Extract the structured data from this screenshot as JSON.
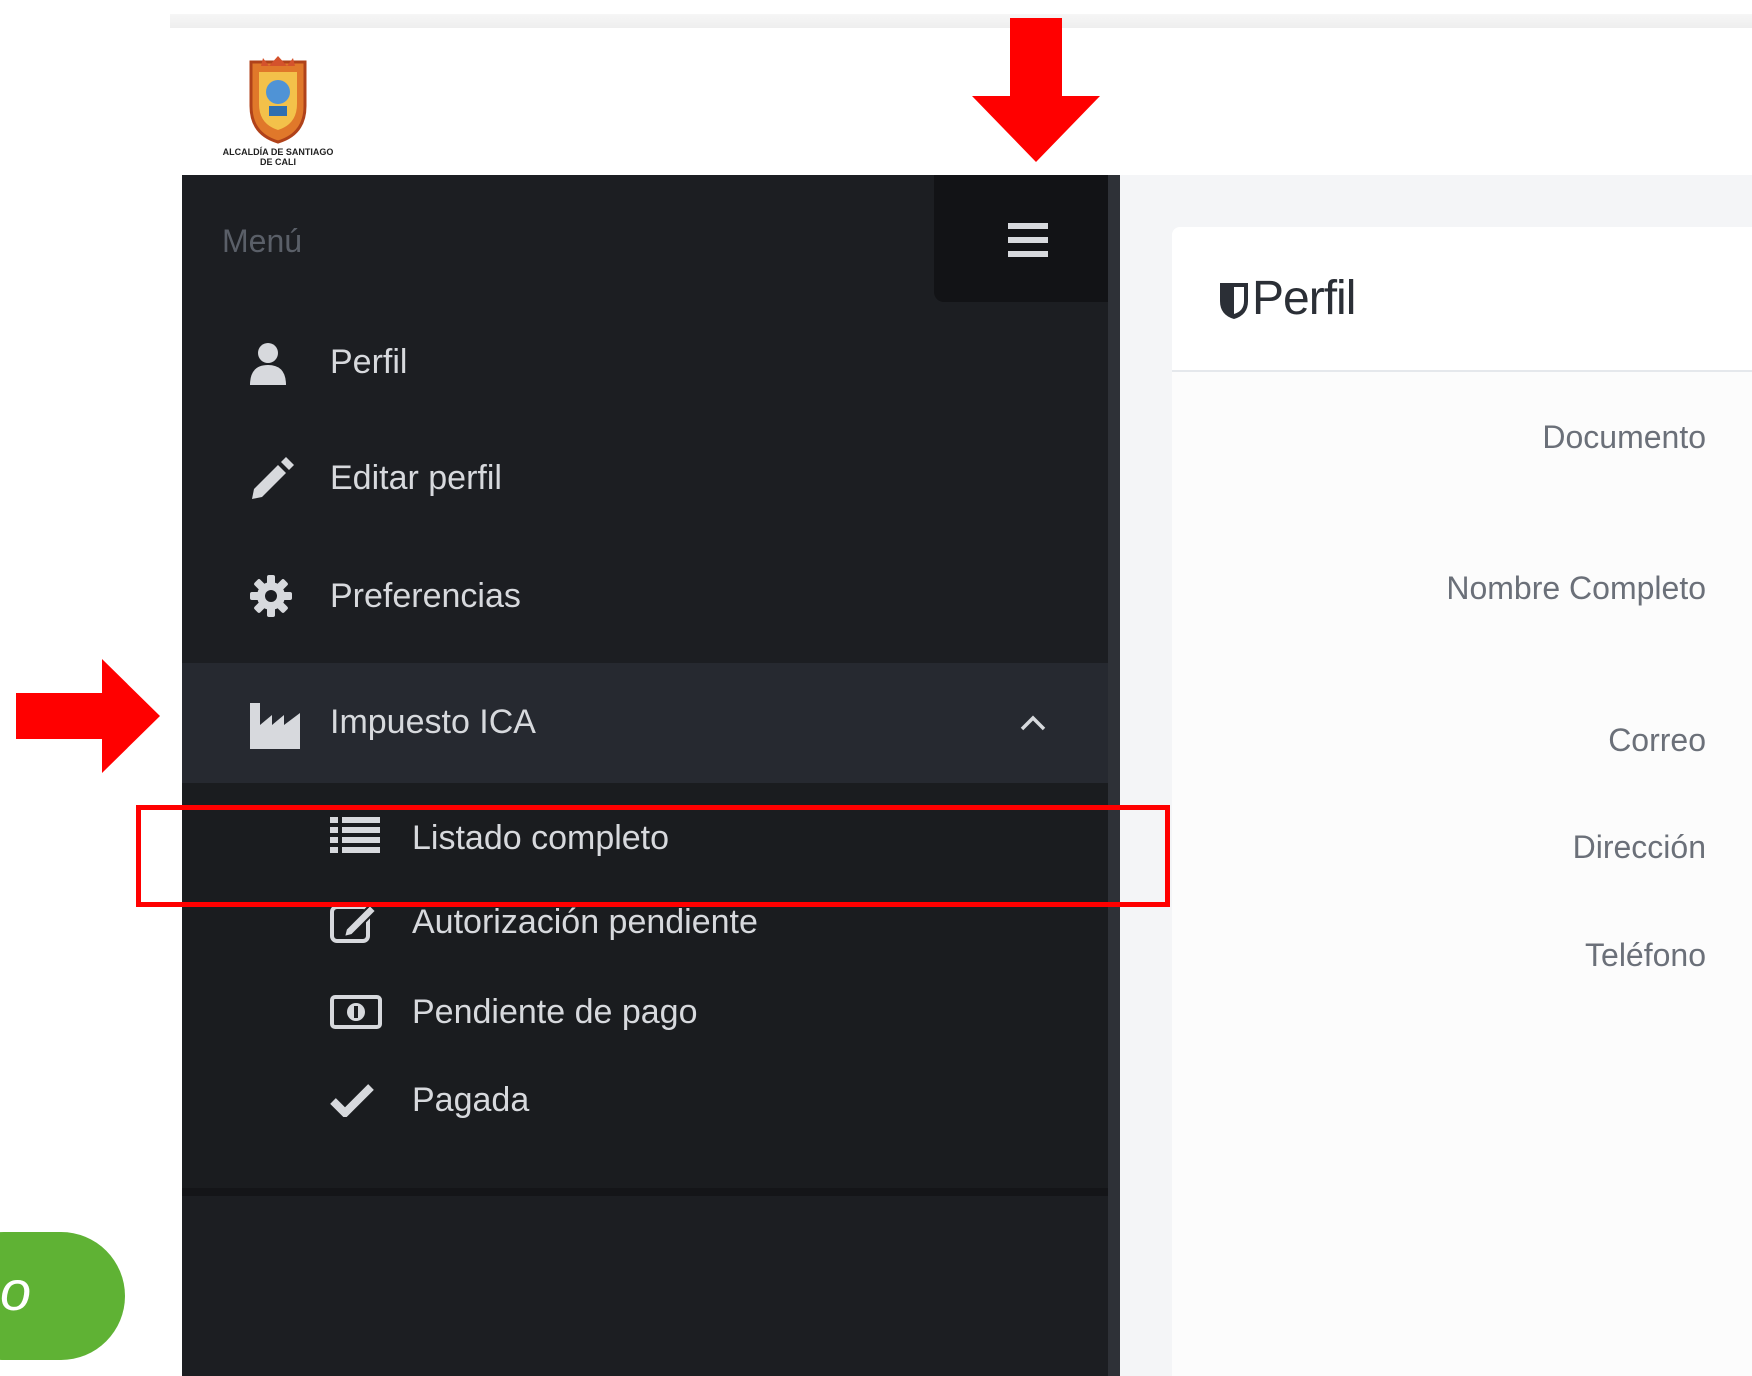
{
  "header": {
    "logo_text": "ALCALDÍA DE SANTIAGO DE CALI"
  },
  "sidebar": {
    "heading": "Menú",
    "items": [
      {
        "label": "Perfil",
        "icon": "user-icon"
      },
      {
        "label": "Editar perfil",
        "icon": "pencil-icon"
      },
      {
        "label": "Preferencias",
        "icon": "gear-icon"
      },
      {
        "label": "Impuesto ICA",
        "icon": "industry-icon",
        "expanded": true
      }
    ],
    "submenu": [
      {
        "label": "Listado completo",
        "icon": "list-icon",
        "highlighted": true
      },
      {
        "label": "Autorización pendiente",
        "icon": "edit-square-icon"
      },
      {
        "label": "Pendiente de pago",
        "icon": "money-bill-icon"
      },
      {
        "label": "Pagada",
        "icon": "check-icon"
      }
    ]
  },
  "profile": {
    "title": "Perfil",
    "fields": [
      "Documento",
      "Nombre Completo",
      "Correo",
      "Dirección",
      "Teléfono"
    ]
  },
  "floating_button": {
    "text": "o"
  },
  "colors": {
    "sidebar_bg": "#1c1e22",
    "annotation_red": "#ff0000",
    "button_green": "#5fb234"
  }
}
